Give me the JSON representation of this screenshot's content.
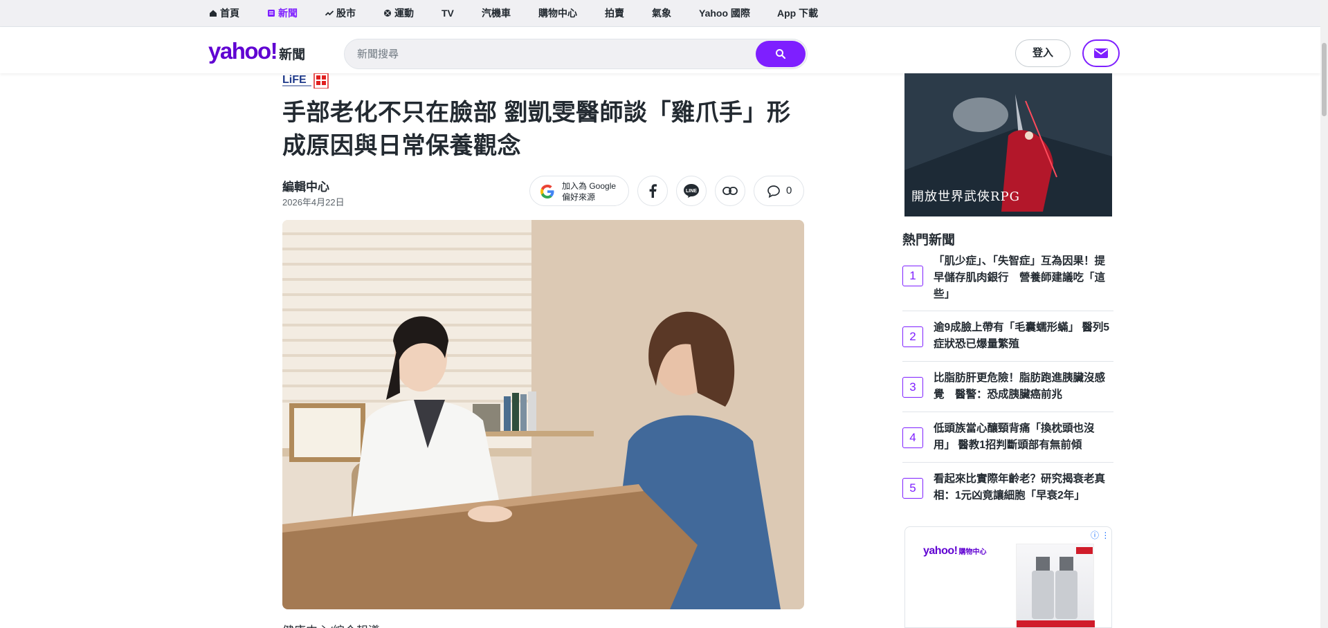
{
  "topnav": {
    "items": [
      {
        "label": "首頁",
        "icon": "home-icon"
      },
      {
        "label": "新聞",
        "icon": "news-icon",
        "active": true
      },
      {
        "label": "股市",
        "icon": "stocks-icon"
      },
      {
        "label": "運動",
        "icon": "sports-icon"
      },
      {
        "label": "TV"
      },
      {
        "label": "汽機車"
      },
      {
        "label": "購物中心"
      },
      {
        "label": "拍賣"
      },
      {
        "label": "氣象"
      },
      {
        "label": "Yahoo 國際"
      },
      {
        "label": "App 下載"
      }
    ],
    "accent": "#7e1fff"
  },
  "header": {
    "logo_brand": "yahoo!",
    "logo_section": "新聞",
    "search_placeholder": "新聞搜尋",
    "login_label": "登入",
    "brand_color": "#6001d2"
  },
  "article": {
    "source_logo": "LiFE",
    "headline": "手部老化不只在臉部 劉凱雯醫師談「雞爪手」形成原因與日常保養觀念",
    "author": "編輯中心",
    "date": "2026年4月22日",
    "google_btn": "加入為 Google\n偏好來源",
    "comment_count": "0",
    "caption": "健康中心/綜合報導"
  },
  "sidebar": {
    "ad_top_text": "開放世界武俠RPG",
    "hot_title": "熱門新聞",
    "hot_news": [
      {
        "num": "1",
        "title": "「肌少症」、「失智症」互為因果！提早儲存肌肉銀行　營養師建議吃「這些」"
      },
      {
        "num": "2",
        "title": "逾9成臉上帶有「毛囊蠕形蟎」 醫列5症狀恐已爆量繁殖"
      },
      {
        "num": "3",
        "title": "比脂肪肝更危險！脂肪跑進胰臟沒感覺　醫警：恐成胰臟癌前兆"
      },
      {
        "num": "4",
        "title": "低頭族當心釀頸背痛「換枕頭也沒用」 醫教1招判斷頭部有無前傾"
      },
      {
        "num": "5",
        "title": "看起來比實際年齡老？研究揭衰老真相：1元凶竟讓細胞「早衰2年」"
      }
    ],
    "ad_bottom_logo": "yahoo!",
    "ad_bottom_logo_sub": "購物中心"
  }
}
